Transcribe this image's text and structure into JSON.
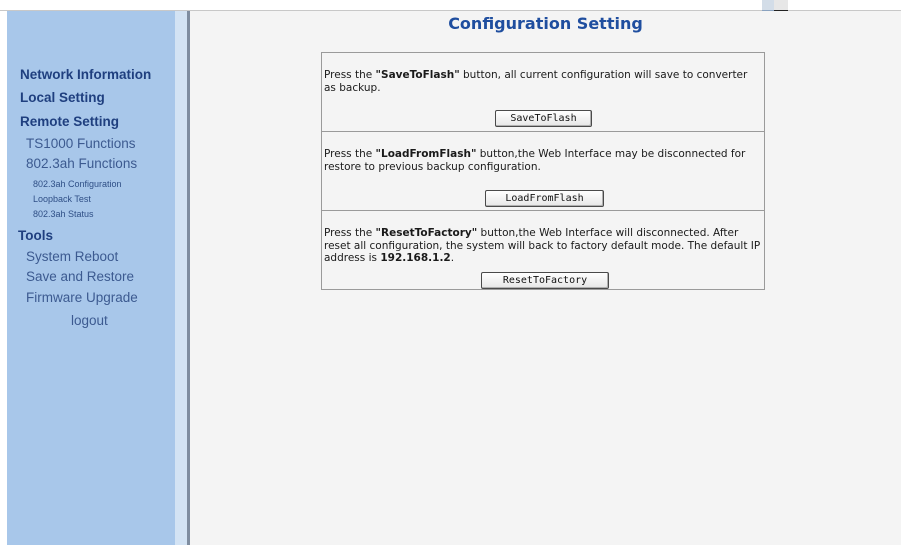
{
  "sidebar": {
    "network_information": "Network Information",
    "local_setting": "Local Setting",
    "remote_setting": "Remote Setting",
    "ts1000_functions": "TS1000 Functions",
    "dot3ah_functions": "802.3ah Functions",
    "dot3ah_configuration": "802.3ah Configuration",
    "loopback_test": "Loopback Test",
    "dot3ah_status": "802.3ah Status",
    "tools": "Tools",
    "system_reboot": "System Reboot",
    "save_and_restore": "Save and Restore",
    "firmware_upgrade": "Firmware Upgrade",
    "logout": "logout"
  },
  "main": {
    "title": "Configuration Setting",
    "save": {
      "prefix": "Press the ",
      "name": "\"SaveToFlash\"",
      "suffix": " button, all current configuration will save to converter as backup.",
      "button": "SaveToFlash"
    },
    "load": {
      "prefix": "Press the ",
      "name": "\"LoadFromFlash\"",
      "suffix": " button,the Web Interface may be disconnected for restore to previous backup configuration.",
      "button": "LoadFromFlash"
    },
    "reset": {
      "prefix": "Press the ",
      "name": "\"ResetToFactory\"",
      "suffix": " button,the Web Interface will disconnected. After reset all configuration, the system will back to factory default mode. The default IP address is ",
      "ip": "192.168.1.2",
      "end": ".",
      "button": "ResetToFactory"
    }
  },
  "colors": {
    "sidebar_bg": "#a8c7ea",
    "sidebar_stripe": "#d3e3f4",
    "nav_link": "#1f3f7f",
    "title": "#1f4e9f",
    "main_bg": "#f4f4f4"
  }
}
